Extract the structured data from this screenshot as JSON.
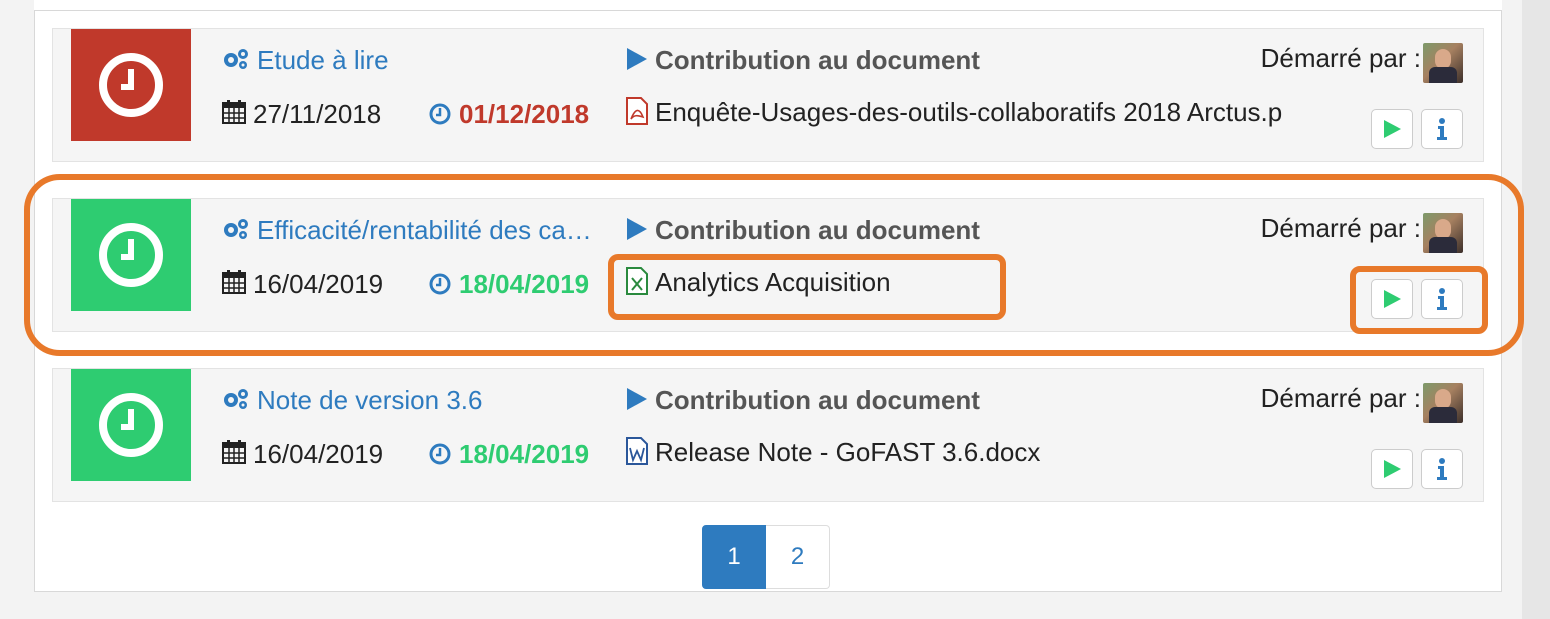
{
  "colors": {
    "late": "#c0392b",
    "on_time": "#2ecc71",
    "link": "#2e7bbf",
    "highlight": "#e8792a"
  },
  "tasks": [
    {
      "status": "late",
      "status_icon": "clock-icon",
      "title": "Etude à lire",
      "title_icon": "cogs-icon",
      "type_label": "Contribution au document",
      "started_by_label": "Démarré par :",
      "start_date": "27/11/2018",
      "due_date": "01/12/2018",
      "document": "Enquête-Usages-des-outils-collaboratifs 2018 Arctus.p",
      "document_icon": "pdf-file-icon"
    },
    {
      "status": "on_time",
      "status_icon": "clock-icon",
      "title": "Efficacité/rentabilité des ca…",
      "title_icon": "cogs-icon",
      "type_label": "Contribution au document",
      "started_by_label": "Démarré par :",
      "start_date": "16/04/2019",
      "due_date": "18/04/2019",
      "document": "Analytics Acquisition",
      "document_icon": "excel-file-icon",
      "highlighted": true
    },
    {
      "status": "on_time",
      "status_icon": "clock-icon",
      "title": "Note de version 3.6",
      "title_icon": "cogs-icon",
      "type_label": "Contribution au document",
      "started_by_label": "Démarré par :",
      "start_date": "16/04/2019",
      "due_date": "18/04/2019",
      "document": "Release Note - GoFAST 3.6.docx",
      "document_icon": "word-file-icon"
    }
  ],
  "pagination": {
    "pages": [
      "1",
      "2"
    ],
    "active": "1"
  }
}
